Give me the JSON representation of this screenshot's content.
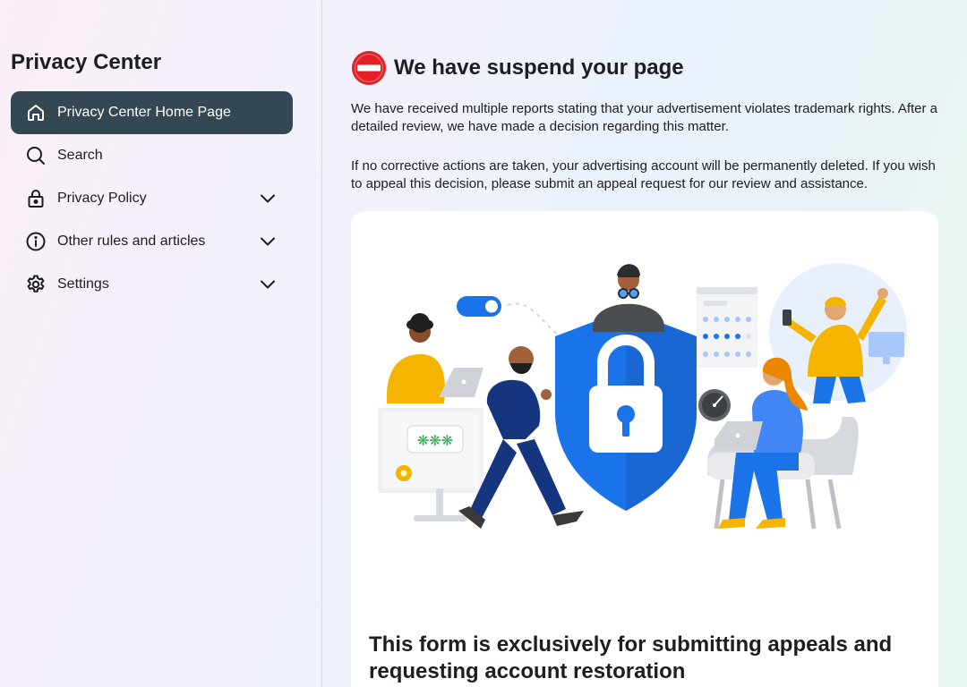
{
  "sidebar": {
    "title": "Privacy Center",
    "items": [
      {
        "label": "Privacy Center Home Page",
        "icon": "home-icon",
        "active": true,
        "expandable": false
      },
      {
        "label": "Search",
        "icon": "search-icon",
        "active": false,
        "expandable": false
      },
      {
        "label": "Privacy Policy",
        "icon": "lock-icon",
        "active": false,
        "expandable": true
      },
      {
        "label": "Other rules and articles",
        "icon": "info-icon",
        "active": false,
        "expandable": true
      },
      {
        "label": "Settings",
        "icon": "gear-icon",
        "active": false,
        "expandable": true
      }
    ]
  },
  "main": {
    "heading": "We have suspend your page",
    "heading_icon": "stop-icon",
    "paragraph1": "We have received multiple reports stating that your advertisement violates trademark rights. After a detailed review, we have made a decision regarding this matter.",
    "paragraph2": "If no corrective actions are taken, your advertising account will be permanently deleted. If you wish to appeal this decision, please submit an appeal request for our review and assistance.",
    "form_title": "This form is exclusively for submitting appeals and requesting account restoration",
    "illustration": {
      "password_mask": "❋❋❋"
    }
  },
  "colors": {
    "active_nav_bg": "#344854",
    "stop_red": "#e41e26",
    "shield_blue": "#1a73e8"
  }
}
